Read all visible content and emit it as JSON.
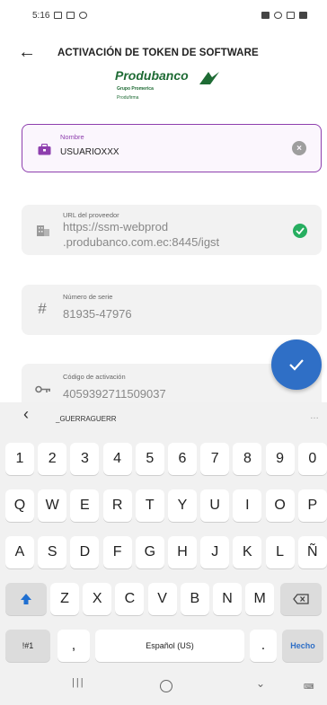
{
  "status_bar": {
    "time": "5:16"
  },
  "header": {
    "back_icon": "arrow-left-icon",
    "title": "ACTIVACIÓN DE TOKEN DE SOFTWARE"
  },
  "logo": {
    "brand": "Produbanco",
    "line1": "Grupo Promerica",
    "line2": "Produfirma"
  },
  "fields": {
    "nombre": {
      "label": "Nombre",
      "value": "USUARIOXXX",
      "icon": "briefcase-icon",
      "accent": "#8e3fae"
    },
    "url": {
      "label": "URL del proveedor",
      "value_line1": "https://ssm-webprod",
      "value_line2": ".produbanco.com.ec:8445/igst",
      "icon": "building-icon",
      "status_color": "#27ae60"
    },
    "serie": {
      "label": "Número de serie",
      "value": "81935-47976",
      "icon": "hash-icon"
    },
    "activacion": {
      "label": "Código de activación",
      "value": "4059392711509037",
      "icon": "key-icon"
    }
  },
  "fab": {
    "icon": "check-icon",
    "color": "#2f6fc6"
  },
  "keyboard": {
    "suggestion": "_GUERRAGUERR",
    "rows": [
      [
        "1",
        "2",
        "3",
        "4",
        "5",
        "6",
        "7",
        "8",
        "9",
        "0"
      ],
      [
        "Q",
        "W",
        "E",
        "R",
        "T",
        "Y",
        "U",
        "I",
        "O",
        "P"
      ],
      [
        "A",
        "S",
        "D",
        "F",
        "G",
        "H",
        "J",
        "K",
        "L",
        "Ñ"
      ],
      [
        "Z",
        "X",
        "C",
        "V",
        "B",
        "N",
        "M"
      ]
    ],
    "symbols_label": "!#1",
    "comma": ",",
    "space_label": "Español (US)",
    "period": ".",
    "done_label": "Hecho",
    "done_color": "#2f6fc6"
  }
}
